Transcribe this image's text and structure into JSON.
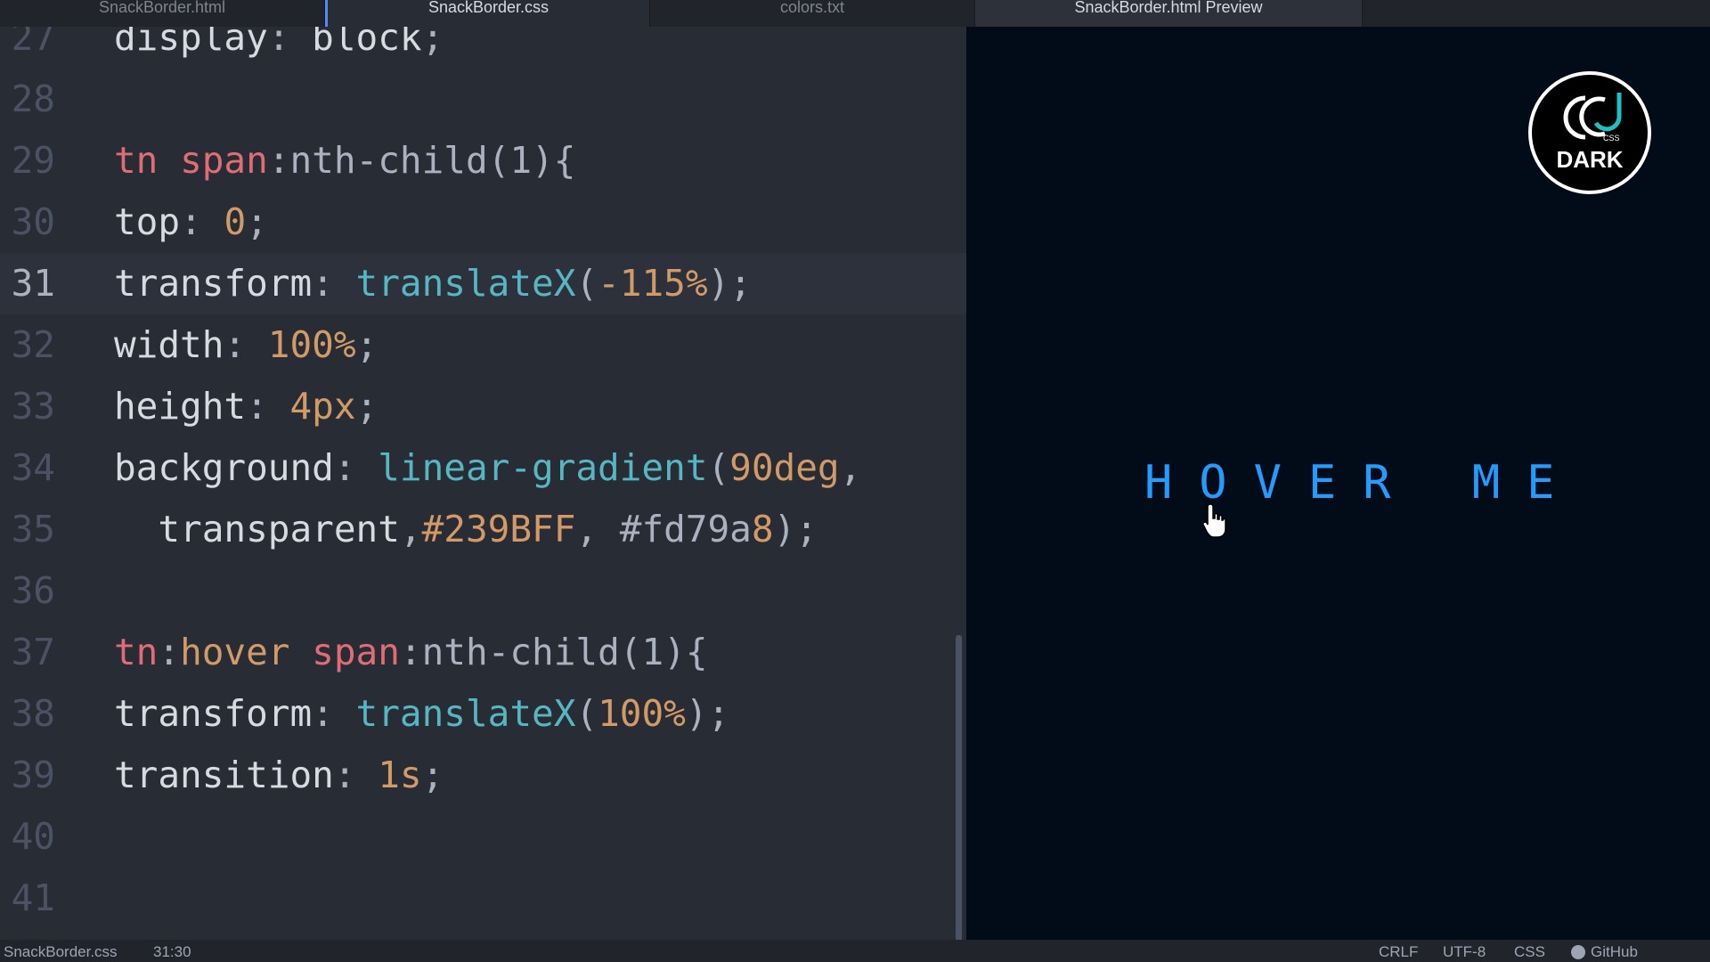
{
  "tabs": [
    {
      "label": "SnackBorder.html"
    },
    {
      "label": "SnackBorder.css"
    },
    {
      "label": "colors.txt"
    },
    {
      "label": "SnackBorder.html Preview"
    }
  ],
  "editor": {
    "lines": [
      {
        "n": "27",
        "t": "display: block;"
      },
      {
        "n": "28",
        "t": ""
      },
      {
        "n": "29",
        "t": "tn span:nth-child(1){"
      },
      {
        "n": "30",
        "t": "top: 0;"
      },
      {
        "n": "31",
        "t": "transform: translateX(-115%);"
      },
      {
        "n": "32",
        "t": "width: 100%;"
      },
      {
        "n": "33",
        "t": "height: 4px;"
      },
      {
        "n": "34",
        "t": "background: linear-gradient(90deg,"
      },
      {
        "n": "35",
        "t": "  transparent,#239BFF, #fd79a8);"
      },
      {
        "n": "36",
        "t": ""
      },
      {
        "n": "37",
        "t": "tn:hover span:nth-child(1){"
      },
      {
        "n": "38",
        "t": "transform: translateX(100%);"
      },
      {
        "n": "39",
        "t": "transition: 1s;"
      },
      {
        "n": "40",
        "t": ""
      },
      {
        "n": "41",
        "t": ""
      }
    ]
  },
  "preview": {
    "hover_text": "HOVER ME",
    "logo_text": "DARK",
    "logo_small": "CSS",
    "text_color": "#239BFF"
  },
  "status": {
    "file": "SnackBorder.css",
    "position": "31:30",
    "line_ending": "CRLF",
    "encoding": "UTF-8",
    "grammar": "CSS",
    "github": "GitHub",
    "github_icon": "github-icon"
  }
}
